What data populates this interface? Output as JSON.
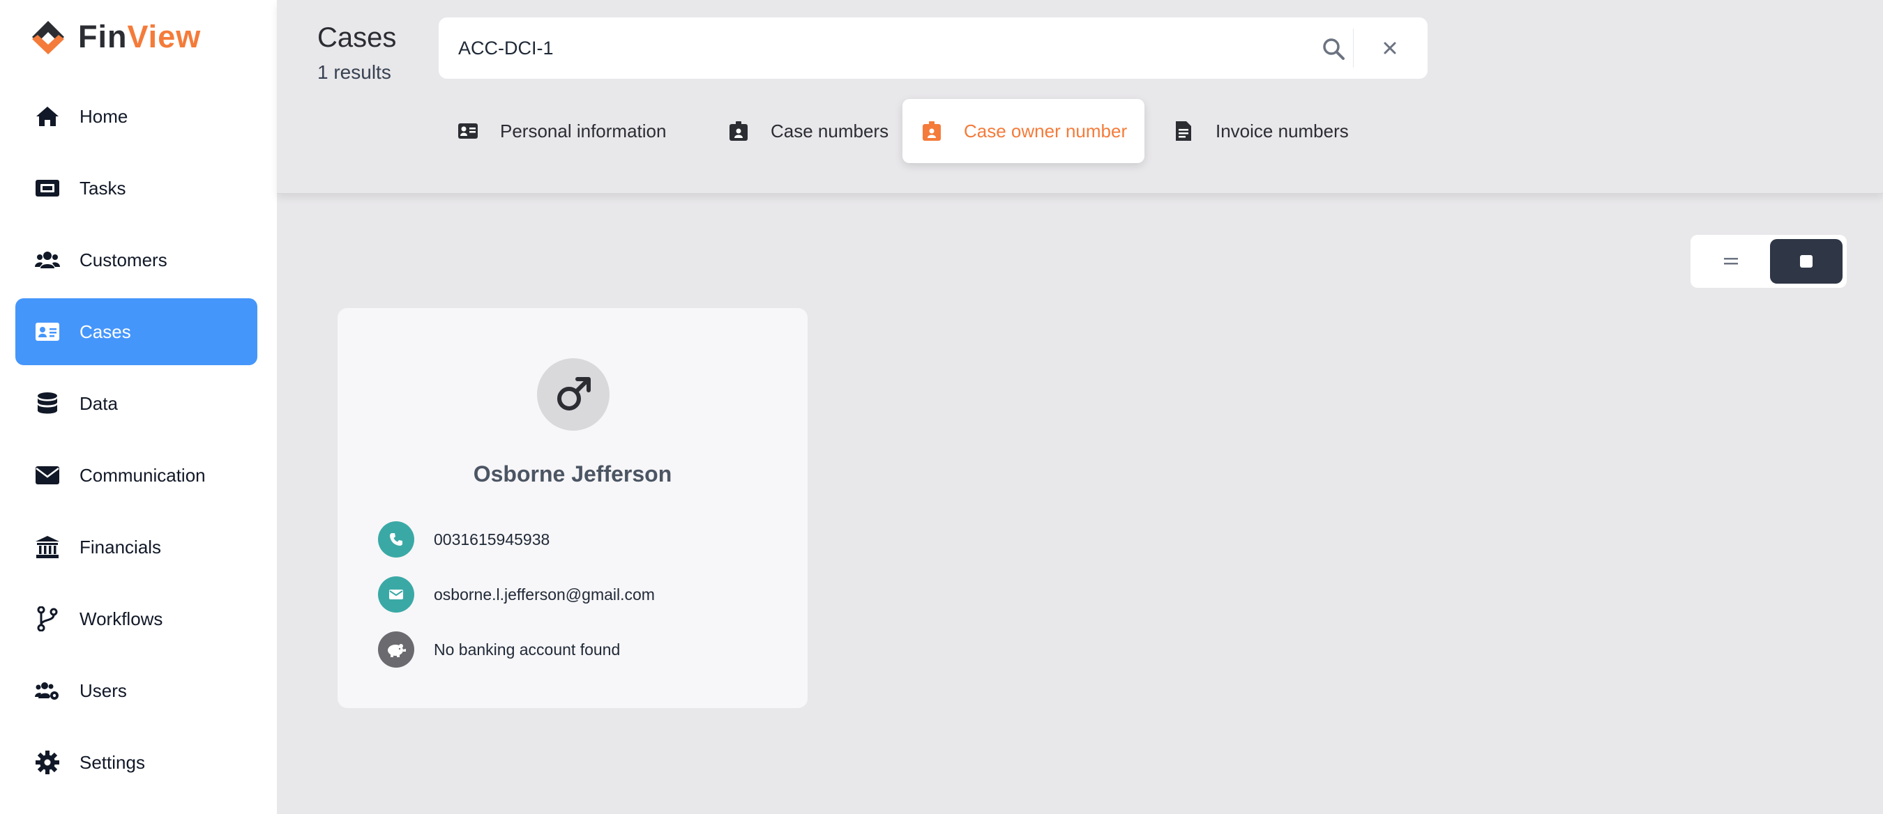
{
  "brand": {
    "fin": "Fin",
    "view": "View",
    "accent": "#f47b3a",
    "dark": "#2b2d33"
  },
  "sidebar": {
    "active_color": "#4596fb",
    "items": [
      {
        "label": "Home",
        "icon": "home-icon"
      },
      {
        "label": "Tasks",
        "icon": "ticket-icon"
      },
      {
        "label": "Customers",
        "icon": "users-icon"
      },
      {
        "label": "Cases",
        "icon": "id-card-icon",
        "active": true
      },
      {
        "label": "Data",
        "icon": "database-icon"
      },
      {
        "label": "Communication",
        "icon": "envelope-icon"
      },
      {
        "label": "Financials",
        "icon": "bank-icon"
      },
      {
        "label": "Workflows",
        "icon": "branch-icon"
      },
      {
        "label": "Users",
        "icon": "users-cog-icon"
      },
      {
        "label": "Settings",
        "icon": "gear-icon"
      }
    ]
  },
  "header": {
    "title": "Cases",
    "results": "1 results",
    "search": {
      "value": "ACC-DCI-1"
    },
    "tabs": [
      {
        "label": "Personal information",
        "icon": "id-card-icon"
      },
      {
        "label": "Case numbers",
        "icon": "badge-icon"
      },
      {
        "label": "Case owner number",
        "icon": "badge-icon",
        "active": true
      },
      {
        "label": "Invoice numbers",
        "icon": "document-icon"
      }
    ]
  },
  "view_toggle": {
    "selected": "grid"
  },
  "card": {
    "name": "Osborne Jefferson",
    "gender_icon": "male-icon",
    "phone": "0031615945938",
    "email": "osborne.l.jefferson@gmail.com",
    "bank": "No banking account found",
    "teal": "#3aa9a6"
  }
}
